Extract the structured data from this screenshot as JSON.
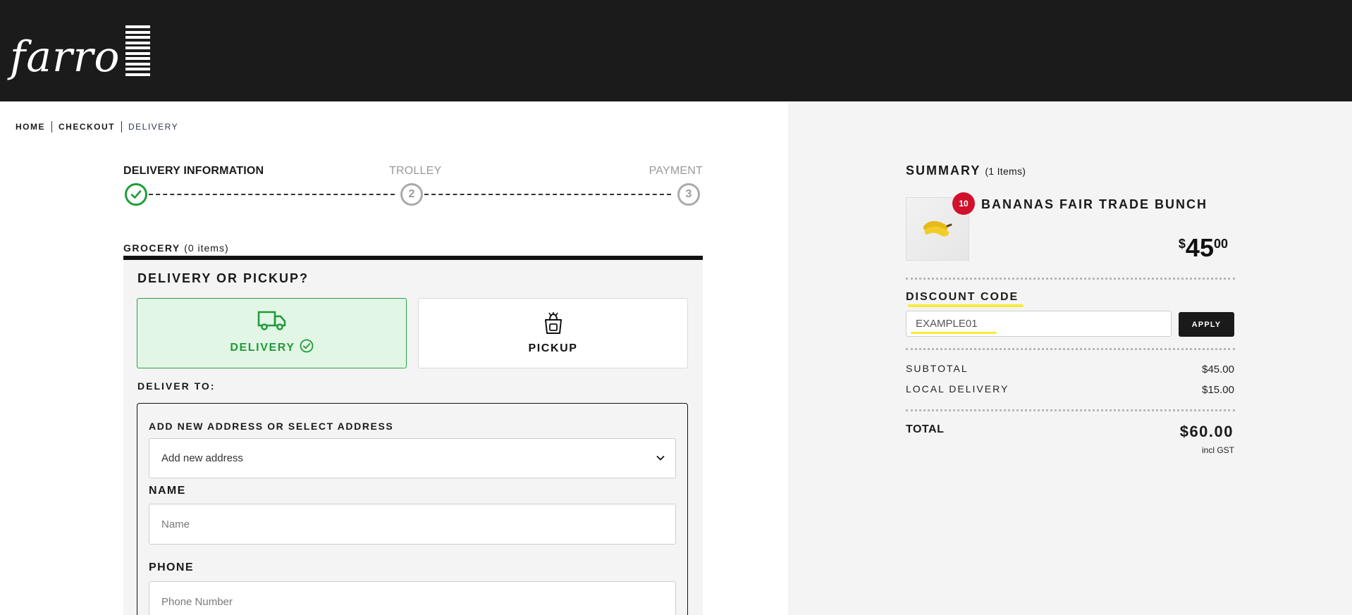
{
  "header": {
    "logo_text": "farro"
  },
  "breadcrumb": {
    "home": "HOME",
    "checkout": "CHECKOUT",
    "current": "DELIVERY"
  },
  "steps": {
    "step1": "DELIVERY INFORMATION",
    "step2": "TROLLEY",
    "step2_num": "2",
    "step3": "PAYMENT",
    "step3_num": "3"
  },
  "grocery": {
    "title": "GROCERY",
    "count": "(0 items)",
    "panel_title": "DELIVERY OR PICKUP?",
    "option_delivery": "DELIVERY",
    "option_pickup": "PICKUP",
    "deliver_to": "DELIVER TO:"
  },
  "address_form": {
    "select_label": "ADD NEW ADDRESS OR SELECT ADDRESS",
    "select_value": "Add new address",
    "name_label": "NAME",
    "name_placeholder": "Name",
    "phone_label": "PHONE",
    "phone_placeholder": "Phone Number"
  },
  "summary": {
    "title": "SUMMARY",
    "item_count": "(1 Items)",
    "item_name": "BANANAS FAIR TRADE BUNCH",
    "item_qty": "10",
    "price_currency": "$",
    "price_whole": "45",
    "price_cents": "00",
    "discount_label": "DISCOUNT CODE",
    "discount_value": "EXAMPLE01",
    "apply_label": "APPLY",
    "subtotal_label": "SUBTOTAL",
    "subtotal_value": "$45.00",
    "delivery_label": "LOCAL DELIVERY",
    "delivery_value": "$15.00",
    "total_label": "TOTAL",
    "total_value": "$60.00",
    "gst_note": "incl GST"
  },
  "colors": {
    "accent_green": "#1f9a3a",
    "badge_red": "#d1102c",
    "highlight_yellow": "#f7ec3a",
    "header_bg": "#1b1b1b"
  }
}
